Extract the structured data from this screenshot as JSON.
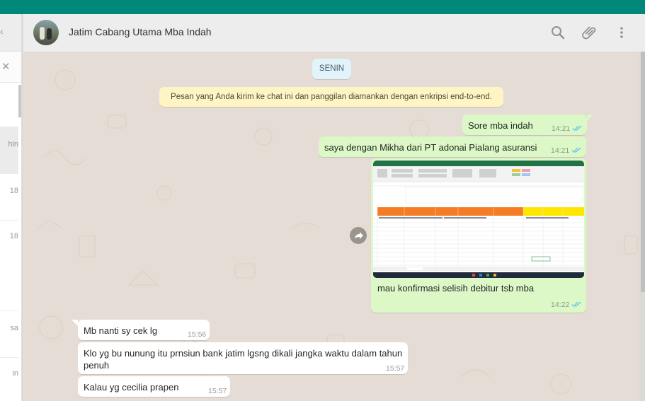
{
  "header": {
    "chat_title": "Jatim Cabang Utama Mba Indah"
  },
  "sidebar": {
    "items": [
      {
        "time": "hin"
      },
      {
        "time": "18"
      },
      {
        "time": "18"
      },
      {
        "time": "sa"
      },
      {
        "time": "in"
      }
    ]
  },
  "chat": {
    "date_divider": "SENIN",
    "encryption_notice": "Pesan yang Anda kirim ke chat ini dan panggilan diamankan dengan enkripsi end-to-end.",
    "messages": [
      {
        "direction": "out",
        "text": "Sore mba indah",
        "time": "14:21",
        "status": "read"
      },
      {
        "direction": "out",
        "text": "saya dengan Mikha dari PT adonai Pialang asuransi",
        "time": "14:21",
        "status": "read"
      },
      {
        "direction": "out",
        "type": "image",
        "caption": "mau konfirmasi selisih debitur tsb mba",
        "time": "14:22",
        "status": "read"
      },
      {
        "direction": "in",
        "text": "Mb nanti sy cek lg",
        "time": "15:56"
      },
      {
        "direction": "in",
        "text": "Klo yg bu nunung itu prnsiun bank jatim lgsng dikali jangka waktu dalam tahun penuh",
        "time": "15:57"
      },
      {
        "direction": "in",
        "text": "Kalau yg cecilia prapen",
        "time": "15:57"
      }
    ]
  },
  "colors": {
    "accent": "#00897b",
    "outgoing_bubble": "#dcf8c6",
    "incoming_bubble": "#ffffff",
    "read_ticks": "#4fc3f7"
  },
  "icons": [
    "search-icon",
    "attach-icon",
    "menu-icon",
    "forward-icon",
    "read-ticks-icon",
    "close-icon"
  ]
}
